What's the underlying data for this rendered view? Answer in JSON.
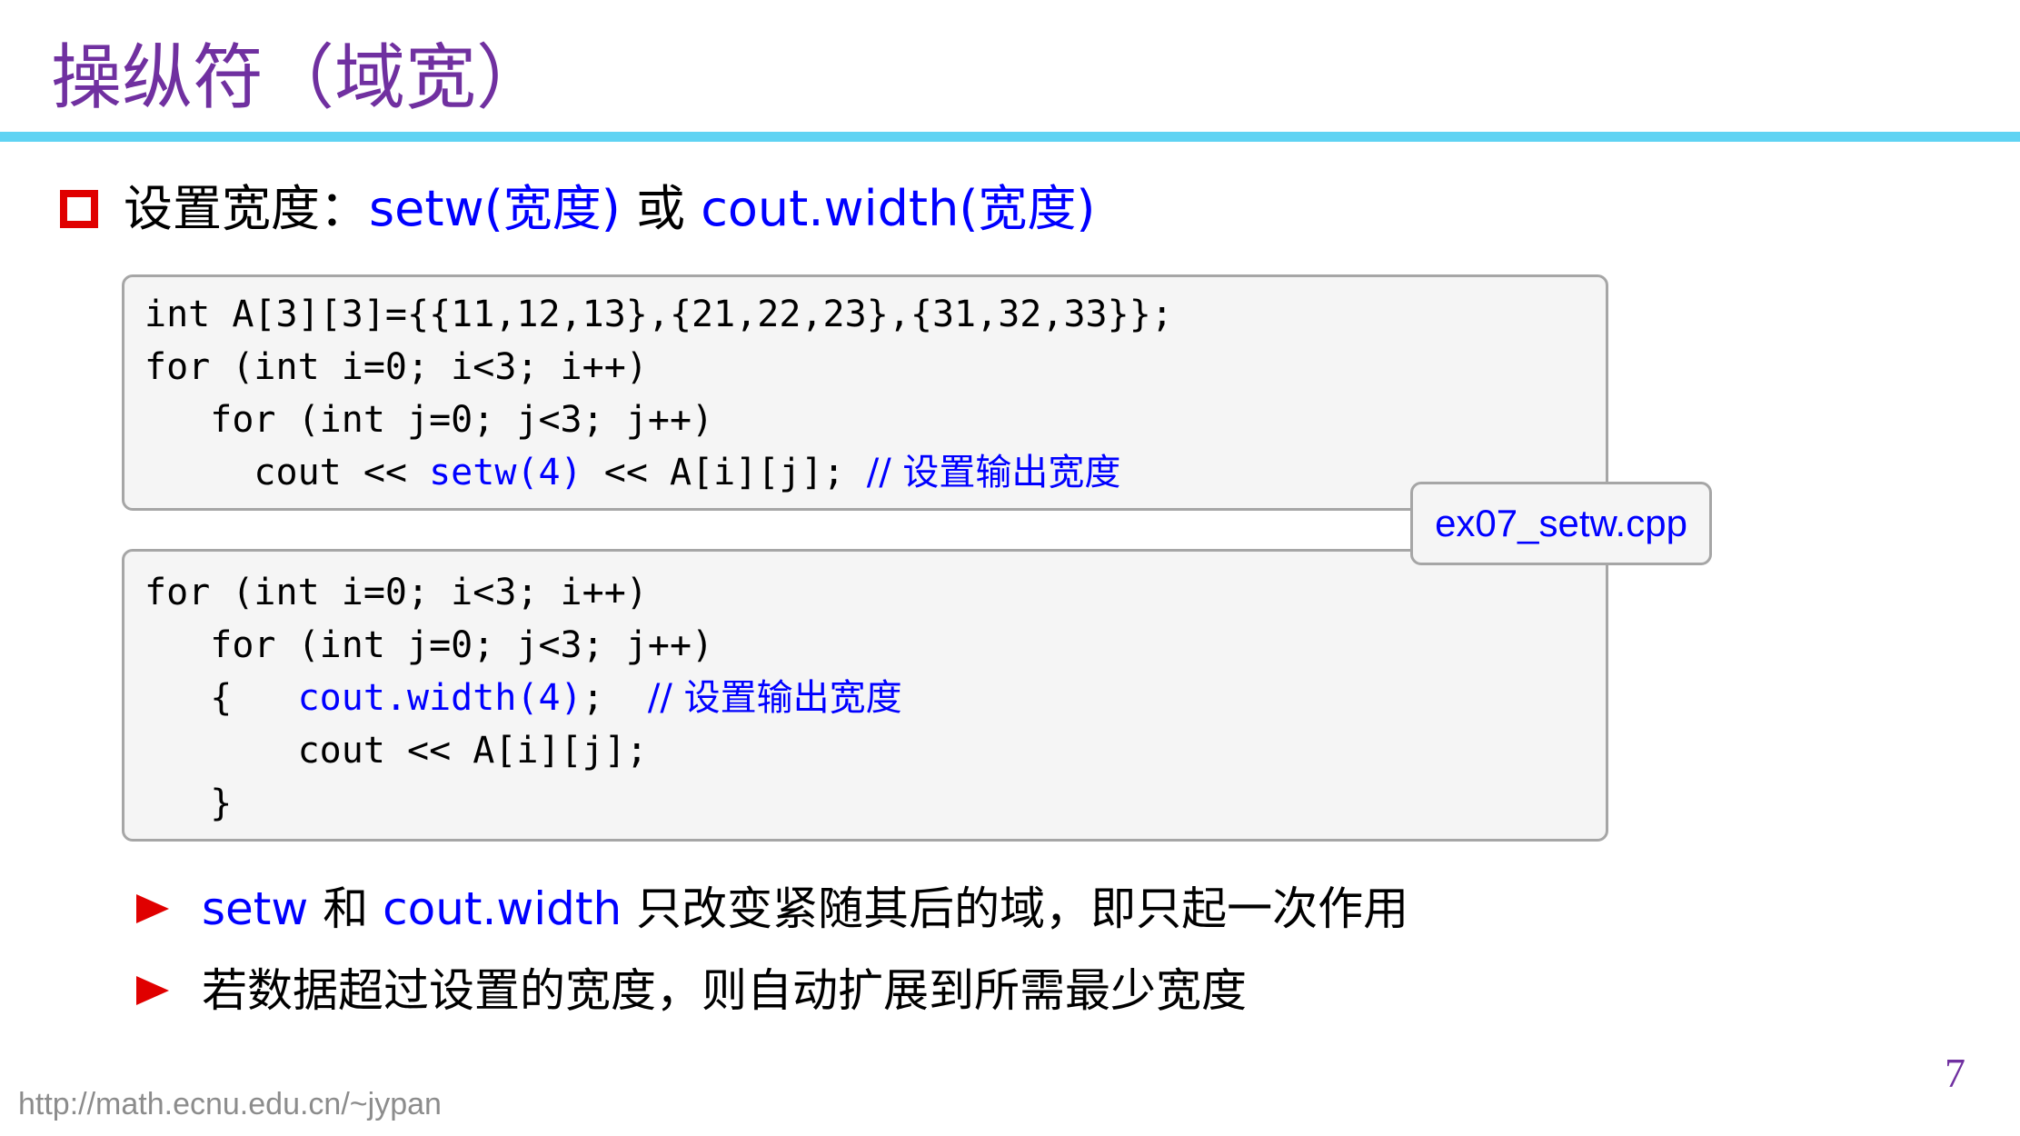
{
  "slide": {
    "title": "操纵符（域宽）",
    "heading": {
      "prefix": "设置宽度：",
      "code1": "setw(宽度)",
      "connector": " 或 ",
      "code2": "cout.width(宽度)"
    },
    "code_block_1": {
      "lines": [
        {
          "text": "int A[3][3]={{11,12,13},{21,22,23},{31,32,33}};"
        },
        {
          "text": "for (int i=0; i<3; i++)"
        },
        {
          "text": "   for (int j=0; j<3; j++)"
        },
        {
          "pre": "     cout << ",
          "highlight": "setw(4)",
          "post": " << A[i][j]; ",
          "comment": "// 设置输出宽度"
        }
      ]
    },
    "file_label": "ex07_setw.cpp",
    "code_block_2": {
      "lines": [
        {
          "text": "for (int i=0; i<3; i++)"
        },
        {
          "text": "   for (int j=0; j<3; j++)"
        },
        {
          "pre": "   {   ",
          "highlight": "cout.width(4)",
          "post": ";  ",
          "comment": "// 设置输出宽度"
        },
        {
          "text": "       cout << A[i][j];"
        },
        {
          "text": "   }"
        }
      ]
    },
    "bullets": [
      {
        "kw1": "setw",
        "mid": " 和 ",
        "kw2": "cout.width",
        "rest": " 只改变紧随其后的域，即只起一次作用"
      },
      {
        "text": "若数据超过设置的宽度，则自动扩展到所需最少宽度"
      }
    ],
    "footer_url": "http://math.ecnu.edu.cn/~jypan",
    "page_number": "7"
  },
  "colors": {
    "title": "#7030a0",
    "accent_rule": "#5fd3f3",
    "bullet_red": "#e00000",
    "keyword_blue": "#0000ff",
    "code_bg": "#f5f5f5",
    "code_border": "#a6a6a6",
    "footer_gray": "#8c8c8c"
  },
  "icons": {
    "heading_bullet": "hollow-square-icon",
    "list_bullet": "right-triangle-icon"
  }
}
